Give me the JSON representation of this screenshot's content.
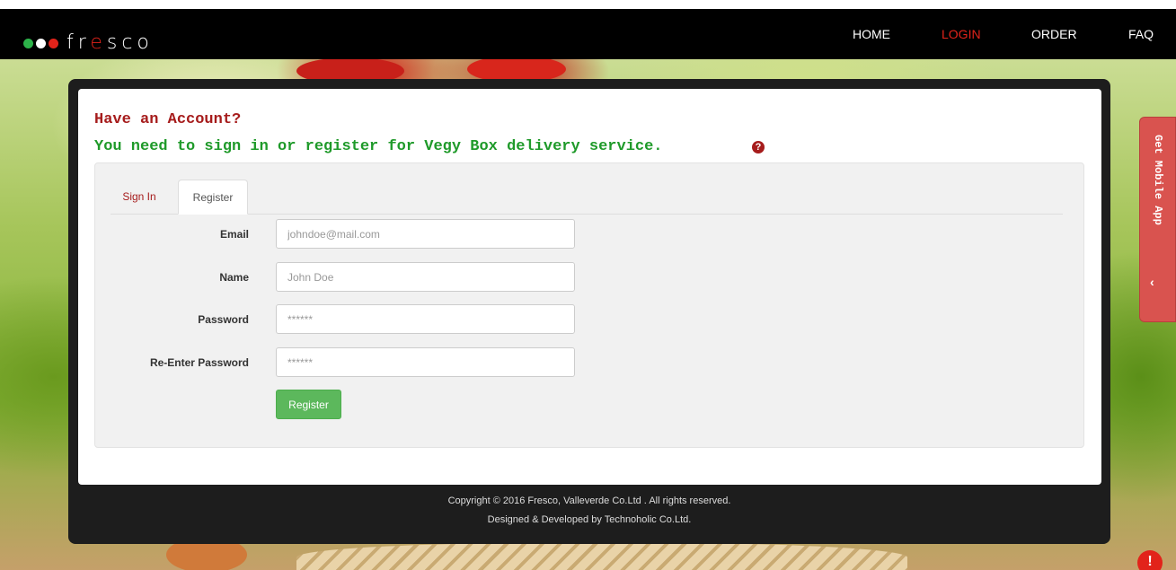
{
  "brand": {
    "logo_text_pre": "fr",
    "logo_text_accent": "e",
    "logo_text_post": "sco",
    "dot_colors": [
      "#2db34a",
      "#ffffff",
      "#e2231a"
    ]
  },
  "nav": {
    "items": [
      {
        "label": "HOME",
        "active": false
      },
      {
        "label": "LOGIN",
        "active": true
      },
      {
        "label": "ORDER",
        "active": false
      },
      {
        "label": "FAQ",
        "active": false
      }
    ]
  },
  "page": {
    "heading": "Have an Account?",
    "subheading": "You need to sign in or register for Vegy Box delivery service.",
    "help_icon": "question-circle-icon"
  },
  "tabs": [
    {
      "label": "Sign In",
      "active": false
    },
    {
      "label": "Register",
      "active": true
    }
  ],
  "form": {
    "fields": [
      {
        "label": "Email",
        "placeholder": "johndoe@mail.com",
        "type": "email"
      },
      {
        "label": "Name",
        "placeholder": "John Doe",
        "type": "text"
      },
      {
        "label": "Password",
        "placeholder": "******",
        "type": "password"
      },
      {
        "label": "Re-Enter Password",
        "placeholder": "******",
        "type": "password"
      }
    ],
    "submit_label": "Register"
  },
  "footer": {
    "copyright": "Copyright © 2016 Fresco, Valleverde Co.Ltd . All rights reserved.",
    "credits": "Designed & Developed by Technoholic Co.Ltd."
  },
  "side_tab": {
    "label": "Get Mobile App",
    "icon": "chevron-down-icon"
  },
  "alert_icon": "alert-icon",
  "colors": {
    "accent_red": "#e2231a",
    "heading_red": "#a61c1c",
    "subheading_green": "#1f9a2a",
    "button_green": "#5cb85c",
    "side_tab_red": "#d9534f"
  }
}
